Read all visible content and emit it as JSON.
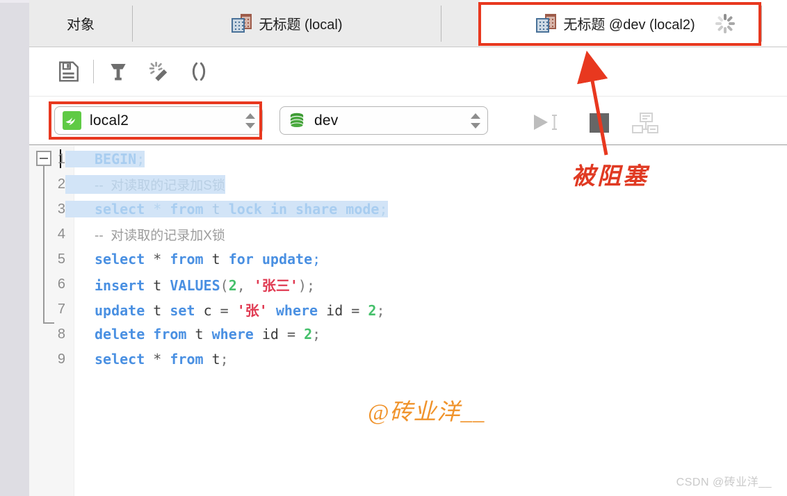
{
  "window": {
    "tabs": [
      {
        "label": "对象",
        "icon": null,
        "active": false,
        "name": "tab-objects"
      },
      {
        "label": "无标题 (local)",
        "icon": "query-building-icon",
        "active": false,
        "name": "tab-untitled-local"
      },
      {
        "label": "无标题 @dev (local2)",
        "icon": "query-building-icon",
        "active": true,
        "name": "tab-untitled-dev-local2",
        "status_icon": "loading-spinner-icon"
      }
    ]
  },
  "toolbar": {
    "buttons": [
      {
        "name": "save-button",
        "icon": "floppy-save-icon",
        "title": "保存"
      },
      {
        "name": "beautify-button",
        "icon": "hammer-icon",
        "title": "美化"
      },
      {
        "name": "format-button",
        "icon": "magic-wand-icon",
        "title": "格式化"
      },
      {
        "name": "parens-button",
        "icon": "parentheses-icon",
        "title": "()"
      }
    ]
  },
  "connection_bar": {
    "connection": {
      "value": "local2",
      "icon": "mysql-dolphin-icon"
    },
    "database": {
      "value": "dev",
      "icon": "database-cylinder-icon"
    },
    "run_button": {
      "name": "run-query-button",
      "icon": "play-triangle-icon",
      "enabled": false
    },
    "stop_button": {
      "name": "stop-query-button",
      "icon": "stop-square-icon",
      "enabled": true
    },
    "plan_button": {
      "name": "explain-plan-button",
      "icon": "explain-plan-icon",
      "enabled": false
    }
  },
  "editor": {
    "lines": [
      {
        "num": "1",
        "selected": true,
        "tokens": [
          {
            "t": "BEGIN",
            "c": "kwl"
          },
          {
            "t": ";",
            "c": "punl"
          }
        ]
      },
      {
        "num": "2",
        "selected": true,
        "tokens": [
          {
            "t": "--  对读取的记录加S锁",
            "c": "cmtl"
          }
        ]
      },
      {
        "num": "3",
        "selected": true,
        "tokens": [
          {
            "t": "select",
            "c": "kwl"
          },
          {
            "t": " ",
            "c": "opl"
          },
          {
            "t": "*",
            "c": "opl"
          },
          {
            "t": " ",
            "c": "opl"
          },
          {
            "t": "from",
            "c": "kwl"
          },
          {
            "t": " ",
            "c": "opl"
          },
          {
            "t": "t",
            "c": "idl"
          },
          {
            "t": " ",
            "c": "opl"
          },
          {
            "t": "lock in share mode",
            "c": "kwl"
          },
          {
            "t": ";",
            "c": "punl"
          }
        ]
      },
      {
        "num": "4",
        "selected": false,
        "tokens": [
          {
            "t": "--  对读取的记录加X锁",
            "c": "cmt"
          }
        ]
      },
      {
        "num": "5",
        "selected": false,
        "tokens": [
          {
            "t": "select",
            "c": "kw"
          },
          {
            "t": " ",
            "c": "op"
          },
          {
            "t": "*",
            "c": "op"
          },
          {
            "t": " ",
            "c": "op"
          },
          {
            "t": "from",
            "c": "kw"
          },
          {
            "t": " ",
            "c": "op"
          },
          {
            "t": "t",
            "c": "id"
          },
          {
            "t": " ",
            "c": "op"
          },
          {
            "t": "for update",
            "c": "kw"
          },
          {
            "t": ";",
            "c": "semi"
          }
        ]
      },
      {
        "num": "6",
        "selected": false,
        "tokens": [
          {
            "t": "insert",
            "c": "kw"
          },
          {
            "t": " ",
            "c": "op"
          },
          {
            "t": "t",
            "c": "id"
          },
          {
            "t": " ",
            "c": "op"
          },
          {
            "t": "VALUES",
            "c": "kw"
          },
          {
            "t": "(",
            "c": "pun"
          },
          {
            "t": "2",
            "c": "num"
          },
          {
            "t": ", ",
            "c": "pun"
          },
          {
            "t": "'张三'",
            "c": "str"
          },
          {
            "t": ")",
            "c": "pun"
          },
          {
            "t": ";",
            "c": "pun"
          }
        ]
      },
      {
        "num": "7",
        "selected": false,
        "tokens": [
          {
            "t": "update",
            "c": "kw"
          },
          {
            "t": " ",
            "c": "op"
          },
          {
            "t": "t",
            "c": "id"
          },
          {
            "t": " ",
            "c": "op"
          },
          {
            "t": "set",
            "c": "kw"
          },
          {
            "t": " ",
            "c": "op"
          },
          {
            "t": "c",
            "c": "id"
          },
          {
            "t": " ",
            "c": "op"
          },
          {
            "t": "=",
            "c": "op"
          },
          {
            "t": " ",
            "c": "op"
          },
          {
            "t": "'张'",
            "c": "str"
          },
          {
            "t": " ",
            "c": "op"
          },
          {
            "t": "where",
            "c": "kw"
          },
          {
            "t": " ",
            "c": "op"
          },
          {
            "t": "id",
            "c": "id"
          },
          {
            "t": " ",
            "c": "op"
          },
          {
            "t": "=",
            "c": "op"
          },
          {
            "t": " ",
            "c": "op"
          },
          {
            "t": "2",
            "c": "num"
          },
          {
            "t": ";",
            "c": "pun"
          }
        ]
      },
      {
        "num": "8",
        "selected": false,
        "tokens": [
          {
            "t": "delete",
            "c": "kw"
          },
          {
            "t": " ",
            "c": "op"
          },
          {
            "t": "from",
            "c": "kw"
          },
          {
            "t": " ",
            "c": "op"
          },
          {
            "t": "t",
            "c": "id"
          },
          {
            "t": " ",
            "c": "op"
          },
          {
            "t": "where",
            "c": "kw"
          },
          {
            "t": " ",
            "c": "op"
          },
          {
            "t": "id",
            "c": "id"
          },
          {
            "t": " ",
            "c": "op"
          },
          {
            "t": "=",
            "c": "op"
          },
          {
            "t": " ",
            "c": "op"
          },
          {
            "t": "2",
            "c": "num"
          },
          {
            "t": ";",
            "c": "pun"
          }
        ]
      },
      {
        "num": "9",
        "selected": false,
        "tokens": [
          {
            "t": "select",
            "c": "kw"
          },
          {
            "t": " ",
            "c": "op"
          },
          {
            "t": "*",
            "c": "op"
          },
          {
            "t": " ",
            "c": "op"
          },
          {
            "t": "from",
            "c": "kw"
          },
          {
            "t": " ",
            "c": "op"
          },
          {
            "t": "t",
            "c": "id"
          },
          {
            "t": ";",
            "c": "pun"
          }
        ]
      }
    ]
  },
  "annotations": {
    "blocked_label": "被阻塞",
    "highlight_color": "#e8381f",
    "code_watermark": "@砖业洋__",
    "footer_watermark": "CSDN @砖业洋__"
  }
}
